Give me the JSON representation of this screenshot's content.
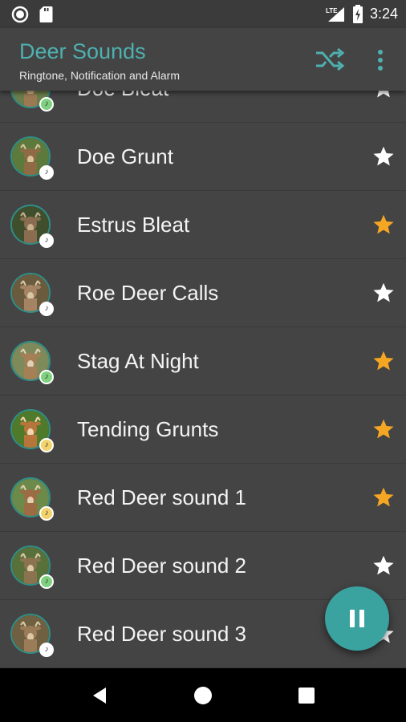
{
  "status_bar": {
    "time": "3:24",
    "network": "LTE"
  },
  "app_bar": {
    "title": "Deer Sounds",
    "subtitle": "Ringtone, Notification and Alarm",
    "icons": [
      "shuffle-icon",
      "more-vert-icon"
    ]
  },
  "sounds": [
    {
      "title": "Doe Bleat",
      "favorite": false,
      "badge": "green"
    },
    {
      "title": "Doe Grunt",
      "favorite": false,
      "badge": "white"
    },
    {
      "title": "Estrus Bleat",
      "favorite": true,
      "badge": "white"
    },
    {
      "title": "Roe Deer Calls",
      "favorite": false,
      "badge": "white"
    },
    {
      "title": "Stag At Night",
      "favorite": true,
      "badge": "green"
    },
    {
      "title": "Tending Grunts",
      "favorite": true,
      "badge": "yellow"
    },
    {
      "title": "Red Deer sound 1",
      "favorite": true,
      "badge": "yellow"
    },
    {
      "title": "Red Deer sound 2",
      "favorite": false,
      "badge": "green"
    },
    {
      "title": "Red Deer sound 3",
      "favorite": false,
      "badge": "white"
    }
  ],
  "fab": {
    "icon": "pause-icon"
  },
  "nav_bar": {
    "icons": [
      "back-icon",
      "home-icon",
      "recents-icon"
    ]
  },
  "colors": {
    "accent": "#4fb0b0",
    "fab": "#3aa39f",
    "star_active": "#f5a623",
    "star_inactive": "#ffffff",
    "background": "#444444"
  }
}
